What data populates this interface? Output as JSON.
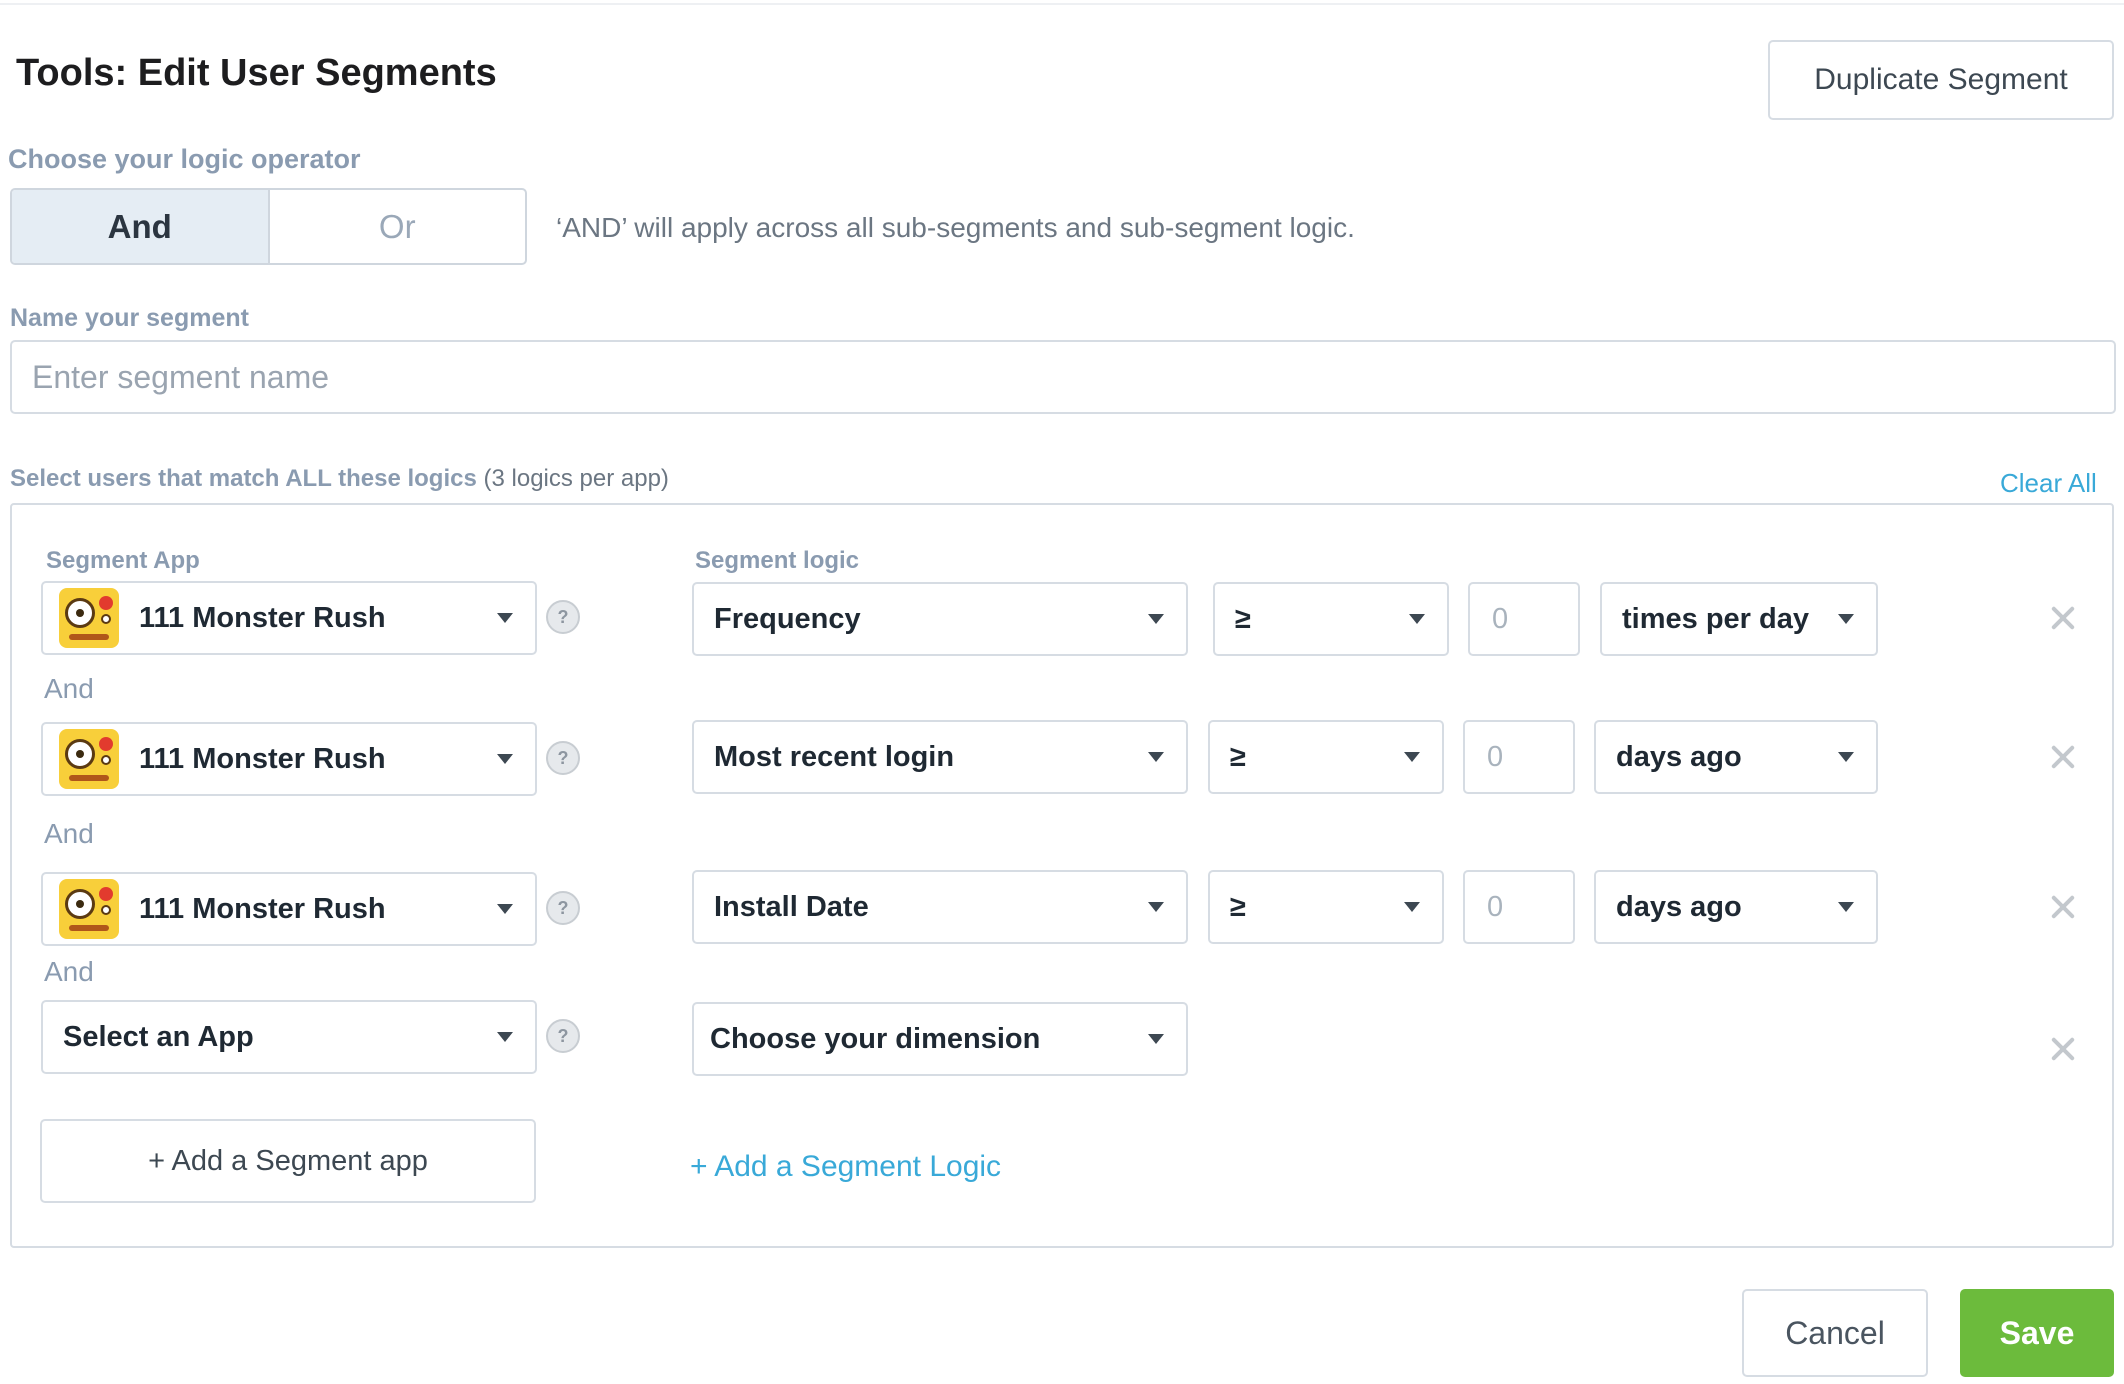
{
  "header": {
    "title": "Tools: Edit User Segments",
    "duplicate_label": "Duplicate Segment"
  },
  "logic_operator": {
    "label": "Choose your logic operator",
    "options": [
      "And",
      "Or"
    ],
    "selected": "And",
    "hint": "‘AND’ will apply across all sub-segments and sub-segment logic."
  },
  "segment_name": {
    "label": "Name your segment",
    "placeholder": "Enter segment name",
    "value": ""
  },
  "match": {
    "label_strong": "Select users that match ALL these logics",
    "label_soft": "(3 logics per app)",
    "clear_all": "Clear All"
  },
  "columns": {
    "app": "Segment App",
    "logic": "Segment logic"
  },
  "rows": [
    {
      "app": "111 Monster Rush",
      "dimension": "Frequency",
      "operator": "≥",
      "value_placeholder": "0",
      "unit": "times per day"
    },
    {
      "app": "111 Monster Rush",
      "dimension": "Most recent login",
      "operator": "≥",
      "value_placeholder": "0",
      "unit": "days ago"
    },
    {
      "app": "111 Monster Rush",
      "dimension": "Install Date",
      "operator": "≥",
      "value_placeholder": "0",
      "unit": "days ago"
    },
    {
      "app": "Select an App",
      "dimension": "Choose your dimension"
    }
  ],
  "joiner": "And",
  "help_glyph": "?",
  "icons": {
    "app": "monster-rush-app-icon",
    "help": "help-icon",
    "remove": "close-icon",
    "caret": "caret-down-icon"
  },
  "actions": {
    "add_app": "+ Add a Segment app",
    "add_logic": "+ Add a Segment Logic",
    "cancel": "Cancel",
    "save": "Save"
  },
  "colors": {
    "accent_blue": "#39a9d8",
    "save_green": "#6cbb3c",
    "label_grey": "#8a9bb0",
    "toggle_active_bg": "#e5edf4"
  }
}
